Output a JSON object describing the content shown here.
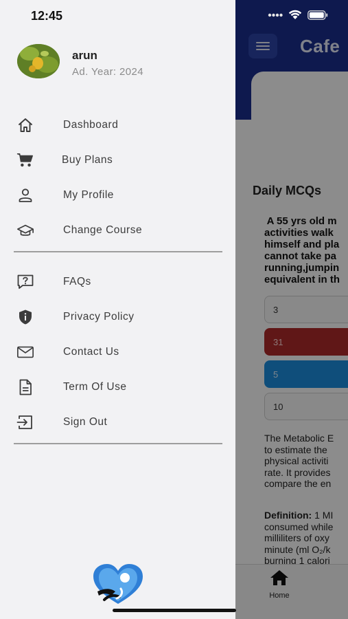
{
  "status_bar": {
    "time": "12:45"
  },
  "drawer": {
    "user": {
      "name": "arun",
      "year": "Ad. Year: 2024"
    },
    "items_primary": [
      {
        "label": "Dashboard",
        "icon": "home-icon"
      },
      {
        "label": "Buy Plans",
        "icon": "cart-icon"
      },
      {
        "label": "My Profile",
        "icon": "person-icon"
      },
      {
        "label": "Change Course",
        "icon": "graduation-cap-icon"
      }
    ],
    "items_secondary": [
      {
        "label": "FAQs",
        "icon": "question-bubble-icon"
      },
      {
        "label": "Privacy Policy",
        "icon": "shield-icon"
      },
      {
        "label": "Contact Us",
        "icon": "mail-icon"
      },
      {
        "label": "Term Of Use",
        "icon": "document-icon"
      },
      {
        "label": "Sign Out",
        "icon": "sign-out-icon"
      }
    ]
  },
  "app": {
    "title": "Cafe",
    "section_title": "Daily MCQs",
    "question": " A 55 yrs old m\nactivities walk\nhimself and pla\ncannot take pa\nrunning,jumpin\nequivalent in th",
    "options": [
      "3",
      "31",
      "5",
      "10"
    ],
    "explanation": "The Metabolic E\nto estimate the \nphysical activiti\nrate. It provides\ncompare the en",
    "definition_label": "Definition:",
    "definition_text": " 1 MI\nconsumed while\nmilliliters of oxy\nminute (ml O₂/k\nburning 1 calori",
    "nav_home": "Home"
  },
  "colors": {
    "header": "#1a2f8f",
    "wrong": "#b02a2a",
    "correct": "#1d8fe0",
    "drawer_bg": "#f2f2f4"
  }
}
